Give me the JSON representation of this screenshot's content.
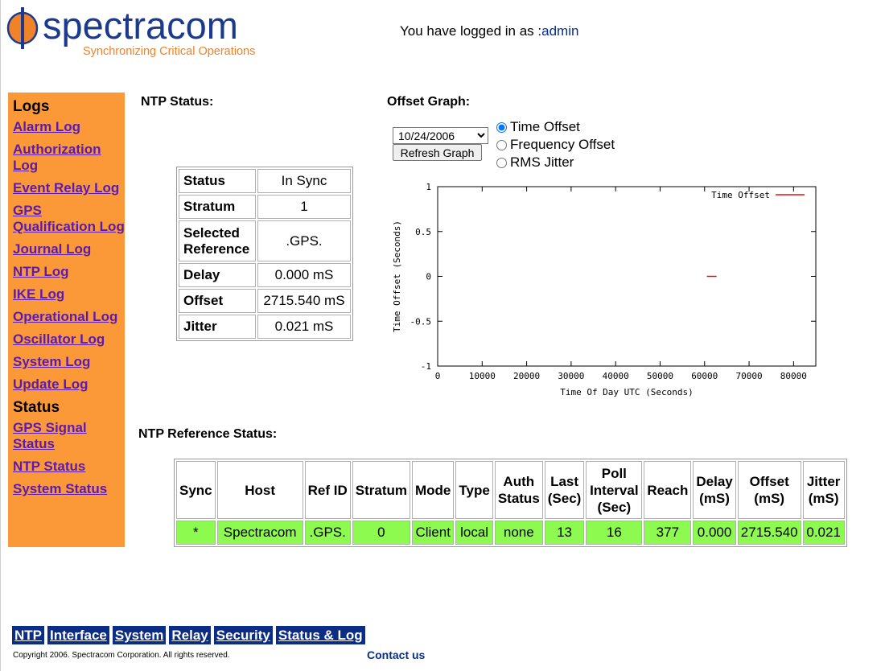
{
  "brand": {
    "name": "spectracom",
    "tagline": "Synchronizing Critical Operations",
    "colors": {
      "name": "#1b3a8f",
      "tagline": "#f0832a",
      "mark": "#f0832a"
    }
  },
  "header": {
    "login_prefix": "You have logged in as :",
    "user": "admin"
  },
  "sidebar": {
    "logs_heading": "Logs",
    "logs": [
      {
        "label": "Alarm Log"
      },
      {
        "label": "Authorization Log"
      },
      {
        "label": "Event Relay Log"
      },
      {
        "label": "GPS Qualification Log"
      },
      {
        "label": "Journal Log"
      },
      {
        "label": "NTP Log"
      },
      {
        "label": "IKE Log"
      },
      {
        "label": "Operational Log"
      },
      {
        "label": "Oscillator Log"
      },
      {
        "label": "System Log"
      },
      {
        "label": "Update Log"
      }
    ],
    "status_heading": "Status",
    "status": [
      {
        "label": "GPS Signal Status"
      },
      {
        "label": "NTP Status"
      },
      {
        "label": "System Status"
      }
    ],
    "colors": {
      "background": "#fb9838",
      "link": "#5a1bb0"
    }
  },
  "ntp_status": {
    "title": "NTP Status:",
    "rows": [
      {
        "label": "Status",
        "value": "In Sync"
      },
      {
        "label": "Stratum",
        "value": "1"
      },
      {
        "label": "Selected Reference",
        "value": ".GPS."
      },
      {
        "label": "Delay",
        "value": "0.000 mS"
      },
      {
        "label": "Offset",
        "value": "2715.540 mS"
      },
      {
        "label": "Jitter",
        "value": "0.021 mS"
      }
    ]
  },
  "offset_graph": {
    "title": "Offset Graph:",
    "date": "10/24/2006",
    "refresh_label": "Refresh Graph",
    "options": [
      {
        "label": "Time Offset",
        "checked": true
      },
      {
        "label": "Frequency Offset",
        "checked": false
      },
      {
        "label": "RMS Jitter",
        "checked": false
      }
    ]
  },
  "chart_data": {
    "type": "scatter",
    "title": "",
    "xlabel": "Time Of Day UTC (Seconds)",
    "ylabel": "Time Offset (Seconds)",
    "xlim": [
      0,
      85000
    ],
    "ylim": [
      -1,
      1
    ],
    "xticks": [
      0,
      10000,
      20000,
      30000,
      40000,
      50000,
      60000,
      70000,
      80000
    ],
    "yticks": [
      1,
      0.5,
      0,
      -0.5,
      -1
    ],
    "ytick_labels": [
      "1",
      "0.5",
      "0",
      "-0.5",
      "-1"
    ],
    "grid": false,
    "legend": "top-right",
    "series": [
      {
        "name": "Time Offset",
        "color": "#e01010",
        "points": [
          {
            "x": 61600,
            "y": 0
          }
        ]
      }
    ]
  },
  "reference": {
    "title": "NTP Reference Status:",
    "headers": [
      "Sync",
      "Host",
      "Ref ID",
      "Stratum",
      "Mode",
      "Type",
      "Auth Status",
      "Last (Sec)",
      "Poll Interval (Sec)",
      "Reach",
      "Delay (mS)",
      "Offset (mS)",
      "Jitter (mS)"
    ],
    "rows": [
      [
        "*",
        "Spectracom",
        ".GPS.",
        "0",
        "Client",
        "local",
        "none",
        "13",
        "16",
        "377",
        "0.000",
        "2715.540",
        "0.021"
      ]
    ],
    "colors": {
      "row": "#8cfa4e"
    }
  },
  "footer": {
    "nav": [
      {
        "label": "NTP"
      },
      {
        "label": "Interface"
      },
      {
        "label": "System"
      },
      {
        "label": "Relay"
      },
      {
        "label": "Security"
      },
      {
        "label": "Status & Log"
      }
    ],
    "copyright": "Copyright 2006. Spectracom Corporation. All rights reserved.",
    "contact": "Contact us",
    "colors": {
      "nav_bg": "#0b2d86"
    }
  }
}
